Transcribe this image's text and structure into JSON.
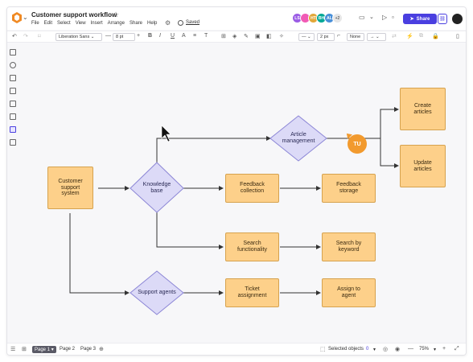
{
  "header": {
    "title": "Customer support workflow",
    "menu": [
      "File",
      "Edit",
      "Select",
      "View",
      "Insert",
      "Arrange",
      "Share",
      "Help"
    ],
    "saved_label": "Saved",
    "avatars": [
      {
        "initials": "LS",
        "color": "#9b5de5"
      },
      {
        "initials": "",
        "color": "#f15bb5"
      },
      {
        "initials": "HT",
        "color": "#e2a83a"
      },
      {
        "initials": "BH",
        "color": "#00a896"
      },
      {
        "initials": "AL",
        "color": "#4a90d9"
      }
    ],
    "avatar_more": "+2",
    "share_label": "Share"
  },
  "toolbar": {
    "font_family": "Liberation Sans",
    "font_size": "8 pt",
    "line_width": "2 px",
    "arrow_start": "None"
  },
  "diagram": {
    "nodes": {
      "customer": "Customer\nsupport\nsystem",
      "knowledge": "Knowledge\nbase",
      "article": "Article\nmanagement",
      "support_agents": "Support agents",
      "create": "Create\narticles",
      "update": "Update\narticles",
      "feedback_collection": "Feedback\ncollection",
      "feedback_storage": "Feedback\nstorage",
      "search_func": "Search\nfunctionality",
      "search_kw": "Search by\nkeyword",
      "ticket": "Ticket\nassignment",
      "assign": "Assign to\nagent"
    },
    "cursor_user": "TU",
    "colors": {
      "box_fill": "#fdd08a",
      "diamond_fill": "#dcdaf7",
      "diamond_stroke": "#8c86d6",
      "connector": "#333333"
    }
  },
  "statusbar": {
    "pages": [
      "Page 1",
      "Page 2",
      "Page 3"
    ],
    "selected_label": "Selected objects",
    "selected_count": "0",
    "zoom": "75%"
  }
}
